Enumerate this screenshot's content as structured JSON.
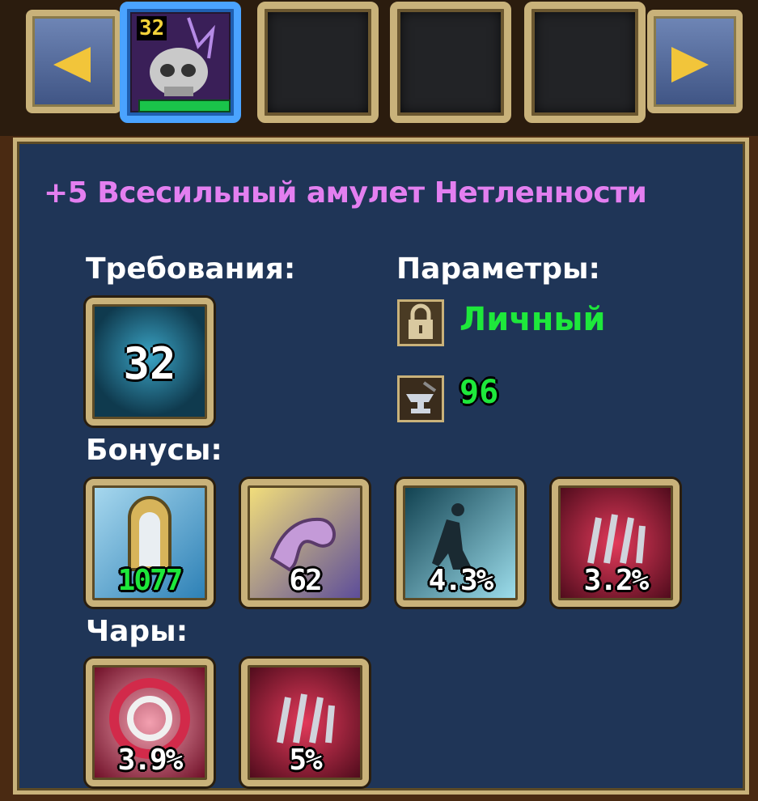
{
  "item_slots": {
    "selected_level_badge": "32",
    "icons": [
      "skull-amulet-icon"
    ]
  },
  "item": {
    "title": "+5 Всесильный амулет Нетленности",
    "requirements_label": "Требования:",
    "required_level": "32",
    "parameters_label": "Параметры:",
    "binding_text": "Личный",
    "durability_value": "96",
    "bonuses_label": "Бонусы:",
    "bonuses": [
      {
        "icon": "armor-shield-icon",
        "value": "1077"
      },
      {
        "icon": "strength-arm-icon",
        "value": "62"
      },
      {
        "icon": "dodge-silhouette-icon",
        "value": "4.3%"
      },
      {
        "icon": "crit-claw-icon",
        "value": "3.2%"
      }
    ],
    "enchants_label": "Чары:",
    "enchants": [
      {
        "icon": "vortex-icon",
        "value": "3.9%"
      },
      {
        "icon": "claw-icon",
        "value": "5%"
      }
    ]
  },
  "colors": {
    "title": "#e37ff0",
    "green_text": "#1ee83b",
    "panel_bg": "#1f3557",
    "frame_gold": "#c9b27a"
  }
}
